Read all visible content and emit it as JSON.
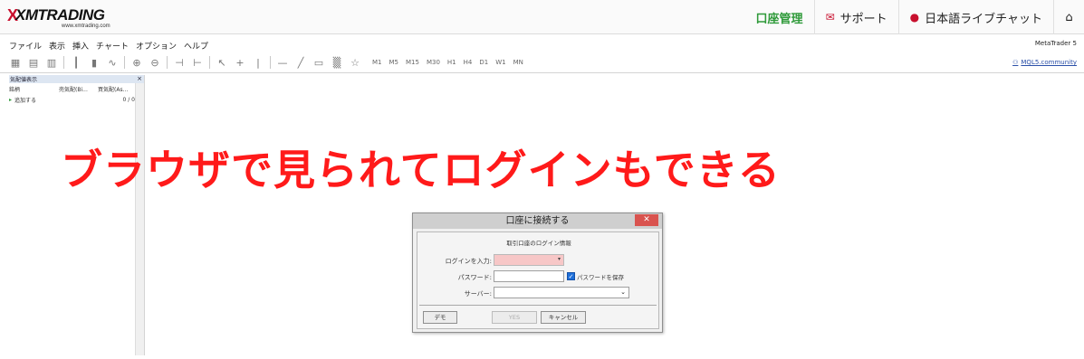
{
  "header": {
    "logo_mark": "X",
    "logo_brand": "XMTRADING",
    "logo_sub": "www.xmtrading.com",
    "nav": [
      {
        "label": "口座管理"
      },
      {
        "label": "サポート",
        "icon": "envelope-icon"
      },
      {
        "label": "日本語ライブチャット",
        "icon": "chat-bubble-icon"
      }
    ],
    "home_icon": "home-icon"
  },
  "menubar": {
    "items": [
      "ファイル",
      "表示",
      "挿入",
      "チャート",
      "オプション",
      "ヘルプ"
    ],
    "app_name": "MetaTrader 5"
  },
  "toolbar": {
    "timeframes": [
      "M1",
      "M5",
      "M15",
      "M30",
      "H1",
      "H4",
      "D1",
      "W1",
      "MN"
    ],
    "community": "MQL5.community"
  },
  "market_watch": {
    "title": "気配値表示",
    "columns": [
      "銘柄",
      "売気配(Bi...",
      "買気配(As..."
    ],
    "add_label": "追加する",
    "count": "0 / 0"
  },
  "headline": "ブラウザで見られてログインもできる",
  "dialog": {
    "title": "口座に接続する",
    "subtitle": "取引口座のログイン情報",
    "login_label": "ログインを入力:",
    "password_label": "パスワード:",
    "save_password_label": "パスワードを保存",
    "server_label": "サーバー:",
    "demo_button": "デモ",
    "yes_button": "YES",
    "cancel_button": "キャンセル",
    "close_symbol": "✕"
  },
  "colors": {
    "accent_red": "#c8102e",
    "nav_green": "#2f9a3a",
    "headline": "#ff1a1a"
  }
}
